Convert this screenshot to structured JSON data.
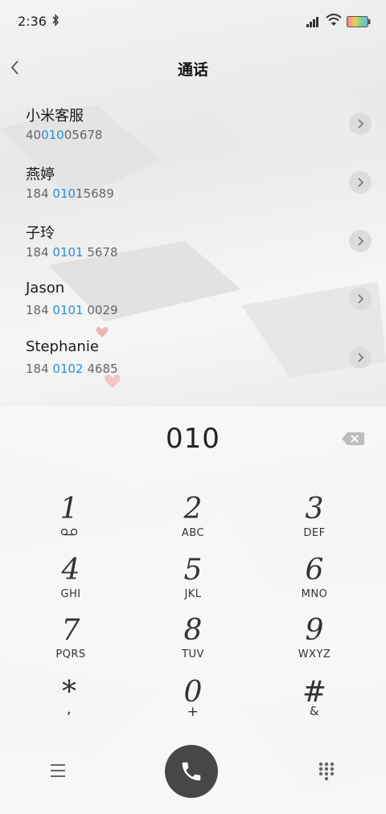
{
  "status_bar": {
    "time": "2:36",
    "bluetooth_icon": "bluetooth-icon",
    "signal_icon": "signal-icon",
    "wifi_icon": "wifi-icon",
    "battery_icon": "battery-icon"
  },
  "header": {
    "title": "通话",
    "back_icon": "chevron-left-icon"
  },
  "contacts": [
    {
      "name": "小米客服",
      "number_pre": "40",
      "number_match": "010",
      "number_post": "05678"
    },
    {
      "name": "燕婷",
      "number_pre": "184 ",
      "number_match": "010",
      "number_post": "15689"
    },
    {
      "name": "子玲",
      "number_pre": "184 ",
      "number_match": "0101",
      "number_post": " 5678"
    },
    {
      "name": "Jason",
      "number_pre": "184 ",
      "number_match": "0101",
      "number_post": " 0029"
    },
    {
      "name": "Stephanie",
      "number_pre": "184 ",
      "number_match": "0102",
      "number_post": " 4685"
    }
  ],
  "dialer": {
    "dialed_number": "010",
    "keys": [
      {
        "digit": "1",
        "letters": ""
      },
      {
        "digit": "2",
        "letters": "ABC"
      },
      {
        "digit": "3",
        "letters": "DEF"
      },
      {
        "digit": "4",
        "letters": "GHI"
      },
      {
        "digit": "5",
        "letters": "JKL"
      },
      {
        "digit": "6",
        "letters": "MNO"
      },
      {
        "digit": "7",
        "letters": "PQRS"
      },
      {
        "digit": "8",
        "letters": "TUV"
      },
      {
        "digit": "9",
        "letters": "WXYZ"
      },
      {
        "digit": "*",
        "letters": ","
      },
      {
        "digit": "0",
        "letters": "+"
      },
      {
        "digit": "#",
        "letters": "&"
      }
    ],
    "voicemail_icon": "voicemail-icon",
    "menu_icon": "menu-icon",
    "call_icon": "phone-icon",
    "keypad_icon": "keypad-icon",
    "backspace_icon": "backspace-icon"
  },
  "colors": {
    "match_highlight": "#2a8fd6",
    "call_button": "#474747"
  }
}
